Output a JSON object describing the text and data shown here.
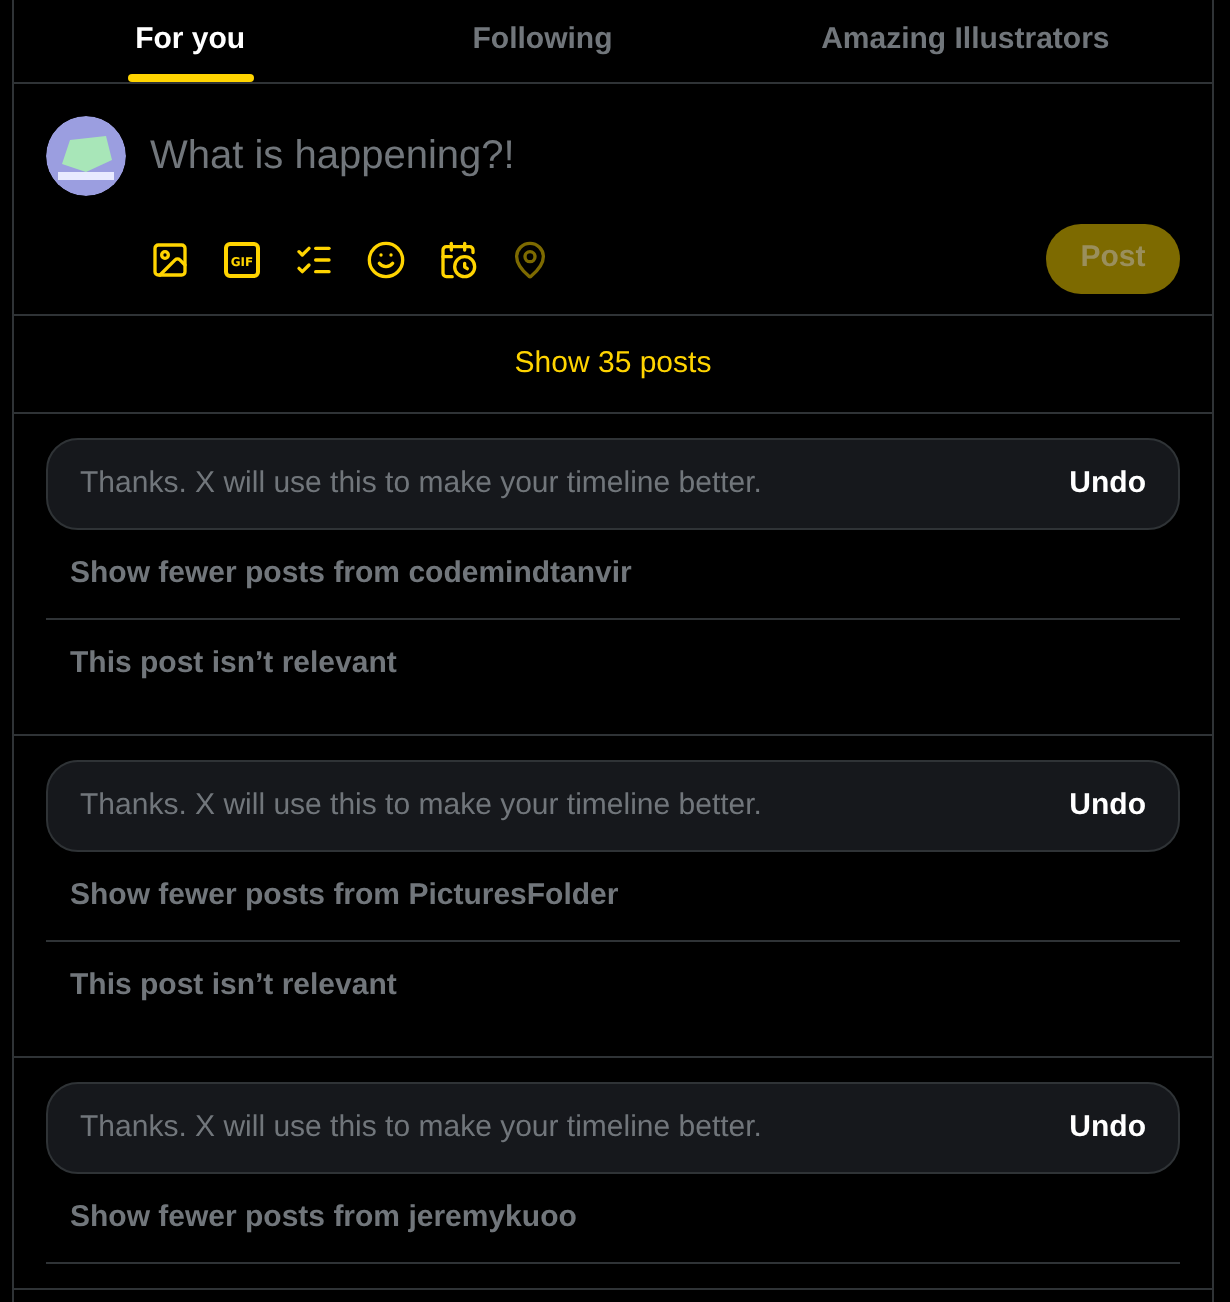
{
  "tabs": [
    {
      "label": "For you",
      "selected": true
    },
    {
      "label": "Following",
      "selected": false
    },
    {
      "label": "Amazing Illustrators",
      "selected": false
    }
  ],
  "composer": {
    "placeholder": "What is happening?!",
    "tools": [
      {
        "kind": "image",
        "disabled": false
      },
      {
        "kind": "gif",
        "label": "GIF",
        "disabled": false
      },
      {
        "kind": "poll",
        "disabled": false
      },
      {
        "kind": "emoji",
        "disabled": false
      },
      {
        "kind": "schedule",
        "disabled": false
      },
      {
        "kind": "location",
        "disabled": true
      }
    ],
    "post_button": {
      "label": "Post",
      "disabled": true
    }
  },
  "show_posts": "Show 35 posts",
  "feedback": [
    {
      "message": "Thanks. X will use this to make your timeline better.",
      "undo": "Undo",
      "options": [
        "Show fewer posts from codemindtanvir",
        "This post isn’t relevant"
      ]
    },
    {
      "message": "Thanks. X will use this to make your timeline better.",
      "undo": "Undo",
      "options": [
        "Show fewer posts from PicturesFolder",
        "This post isn’t relevant"
      ]
    },
    {
      "message": "Thanks. X will use this to make your timeline better.",
      "undo": "Undo",
      "options": [
        "Show fewer posts from jeremykuoo"
      ]
    }
  ]
}
